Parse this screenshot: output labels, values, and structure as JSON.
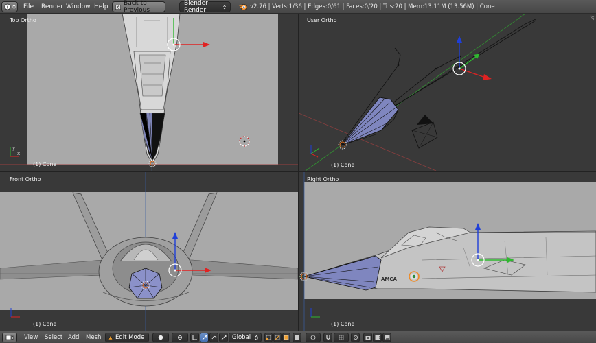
{
  "menu": {
    "file": "File",
    "render": "Render",
    "window": "Window",
    "help": "Help",
    "back_button": "Back to Previous",
    "render_engine": "Blender Render"
  },
  "stats": "v2.76 | Verts:1/36 | Edges:0/61 | Faces:0/20 | Tris:20 | Mem:13.11M (13.56M) | Cone",
  "viewports": [
    {
      "name": "Top Ortho",
      "object": "(1) Cone"
    },
    {
      "name": "User Ortho",
      "object": "(1) Cone"
    },
    {
      "name": "Front Ortho",
      "object": "(1) Cone"
    },
    {
      "name": "Right Ortho",
      "object": "(1) Cone"
    }
  ],
  "bottom": {
    "view": "View",
    "select": "Select",
    "add": "Add",
    "mesh": "Mesh",
    "mode": "Edit Mode",
    "orientation": "Global"
  },
  "fuselage_text": "AMCA",
  "colors": {
    "header_bg": "#4b4b4b",
    "viewport_grey": "#a9a9a9",
    "dark_grey": "#393939",
    "x_axis": "#e02222",
    "y_axis": "#2fb82f",
    "z_axis": "#1f3fd8",
    "selected_face": "#8b91c9"
  },
  "icons": {
    "editor": "info-editor-icon",
    "blender": "blender-logo-icon",
    "view_type": "view3d-editor-icon"
  }
}
